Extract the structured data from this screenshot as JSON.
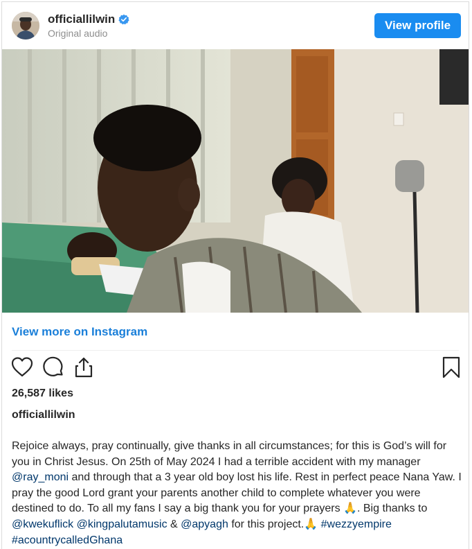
{
  "post": {
    "username": "officiallilwin",
    "subtitle": "Original audio",
    "view_profile_label": "View profile",
    "view_more_label": "View more on Instagram",
    "likes": "26,587 likes",
    "owner": "officiallilwin",
    "caption": {
      "t1": "Rejoice always, pray continually, give thanks in all circumstances; for this is God’s will for you in Christ Jesus. On 25th of May 2024 I had a terrible accident with my manager ",
      "m1": "@ray_moni",
      "t2": " and through that a 3 year old boy lost his life. Rest in perfect peace Nana Yaw. I pray the good Lord grant your parents another child to complete whatever you were destined to do. To all my fans I say a big thank you for your prayers 🙏. Big thanks to ",
      "m2": "@kwekuflick",
      "t3": " ",
      "m3": "@kingpalutamusic",
      "t4": " & ",
      "m4": "@apyagh",
      "t5": " for this project.🙏 ",
      "h1": "#wezzyempire",
      "t6": " ",
      "h2": "#acountrycalledGhana"
    }
  },
  "colors": {
    "accent": "#1a8cf0",
    "link": "#1a7fd9",
    "mention": "#00376b"
  },
  "icons": [
    "heart-icon",
    "comment-icon",
    "share-icon",
    "bookmark-icon",
    "verified-badge-icon"
  ]
}
